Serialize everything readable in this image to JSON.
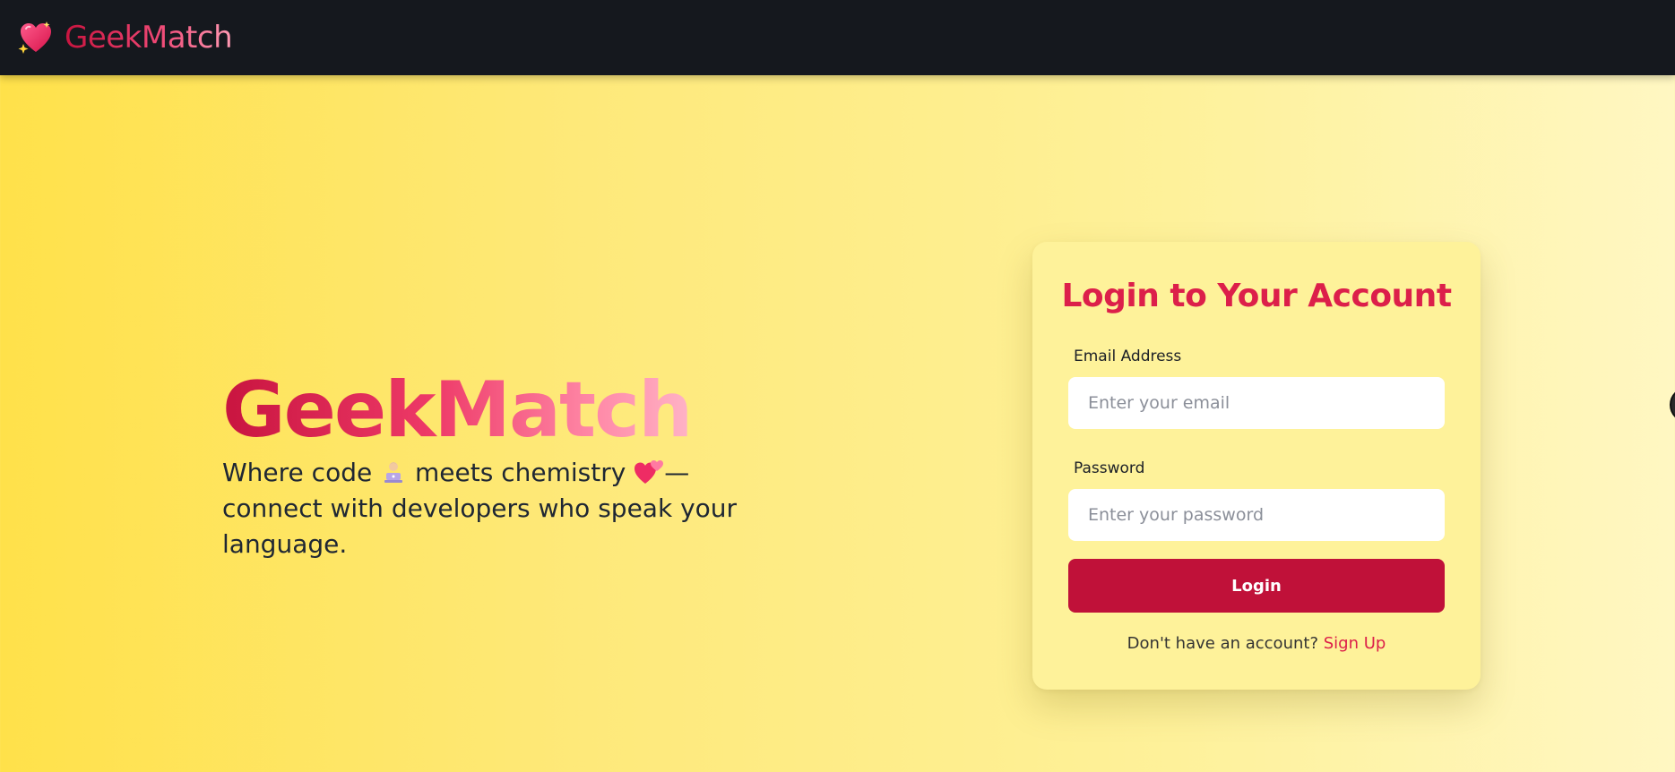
{
  "navbar": {
    "brand": "GeekMatch",
    "logo_icon": "sparkling-heart-icon"
  },
  "hero": {
    "title": "GeekMatch",
    "tagline_part1": "Where code",
    "tagline_icon1": "technologist-icon",
    "tagline_part2": "meets chemistry",
    "tagline_icon2": "two-hearts-icon",
    "tagline_part3": "— connect with developers who speak your language."
  },
  "login": {
    "title": "Login to Your Account",
    "email_label": "Email Address",
    "email_placeholder": "Enter your email",
    "email_value": "",
    "password_label": "Password",
    "password_placeholder": "Enter your password",
    "password_value": "",
    "submit_label": "Login",
    "signup_prompt": "Don't have an account?",
    "signup_link": "Sign Up"
  },
  "colors": {
    "brand_pink": "#dc1f4a",
    "button_crimson": "#c01139",
    "navbar_bg": "#15181e",
    "card_bg": "#fef29a",
    "page_gradient_start": "#ffe14a",
    "page_gradient_end": "#fff7c2"
  }
}
